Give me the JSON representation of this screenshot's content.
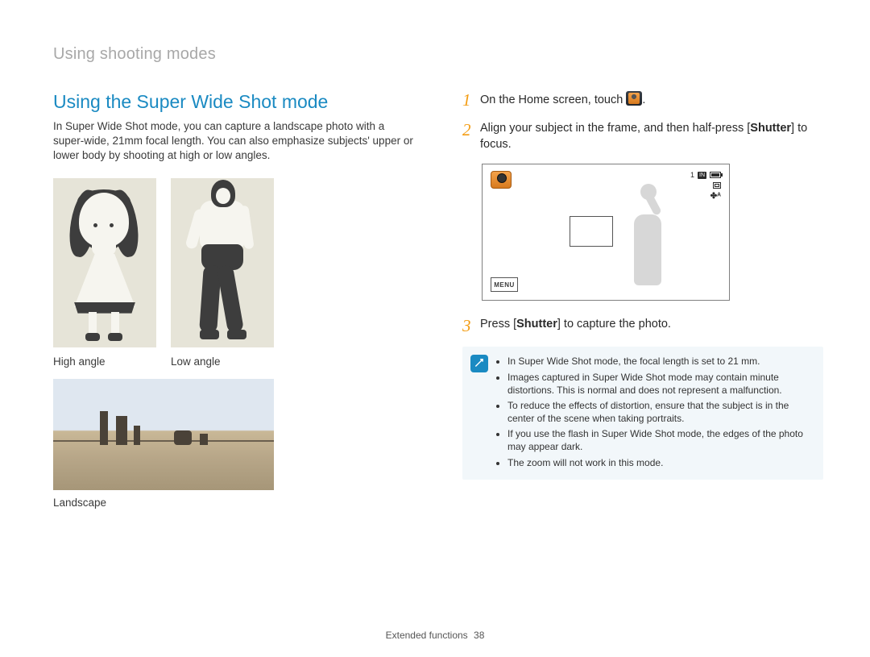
{
  "breadcrumb": "Using shooting modes",
  "section": {
    "title": "Using the Super Wide Shot mode",
    "intro": "In Super Wide Shot mode, you can capture a landscape photo with a super-wide, 21mm focal length. You can also emphasize subjects' upper or lower body by shooting at high or low angles."
  },
  "captions": {
    "high": "High angle",
    "low": "Low angle",
    "landscape": "Landscape"
  },
  "steps": {
    "s1_pre": "On the Home screen, touch ",
    "s1_post": ".",
    "s2_pre": "Align your subject in the frame, and then half-press [",
    "s2_bold": "Shutter",
    "s2_post": "] to focus.",
    "s3_pre": "Press [",
    "s3_bold": "Shutter",
    "s3_post": "] to capture the photo."
  },
  "lcd": {
    "count": "1",
    "in": "IN",
    "menu": "MENU",
    "flash": "✤ᴬ"
  },
  "notes": [
    "In Super Wide Shot mode, the focal length is set to 21 mm.",
    "Images captured in Super Wide Shot mode may contain minute distortions. This is normal and does not represent a malfunction.",
    "To reduce the effects of distortion, ensure that the subject is in the center of the scene when taking portraits.",
    "If you use the flash in Super Wide Shot mode, the edges of the photo may appear dark.",
    "The zoom will not work in this mode."
  ],
  "footer": {
    "section": "Extended functions",
    "page": "38"
  }
}
